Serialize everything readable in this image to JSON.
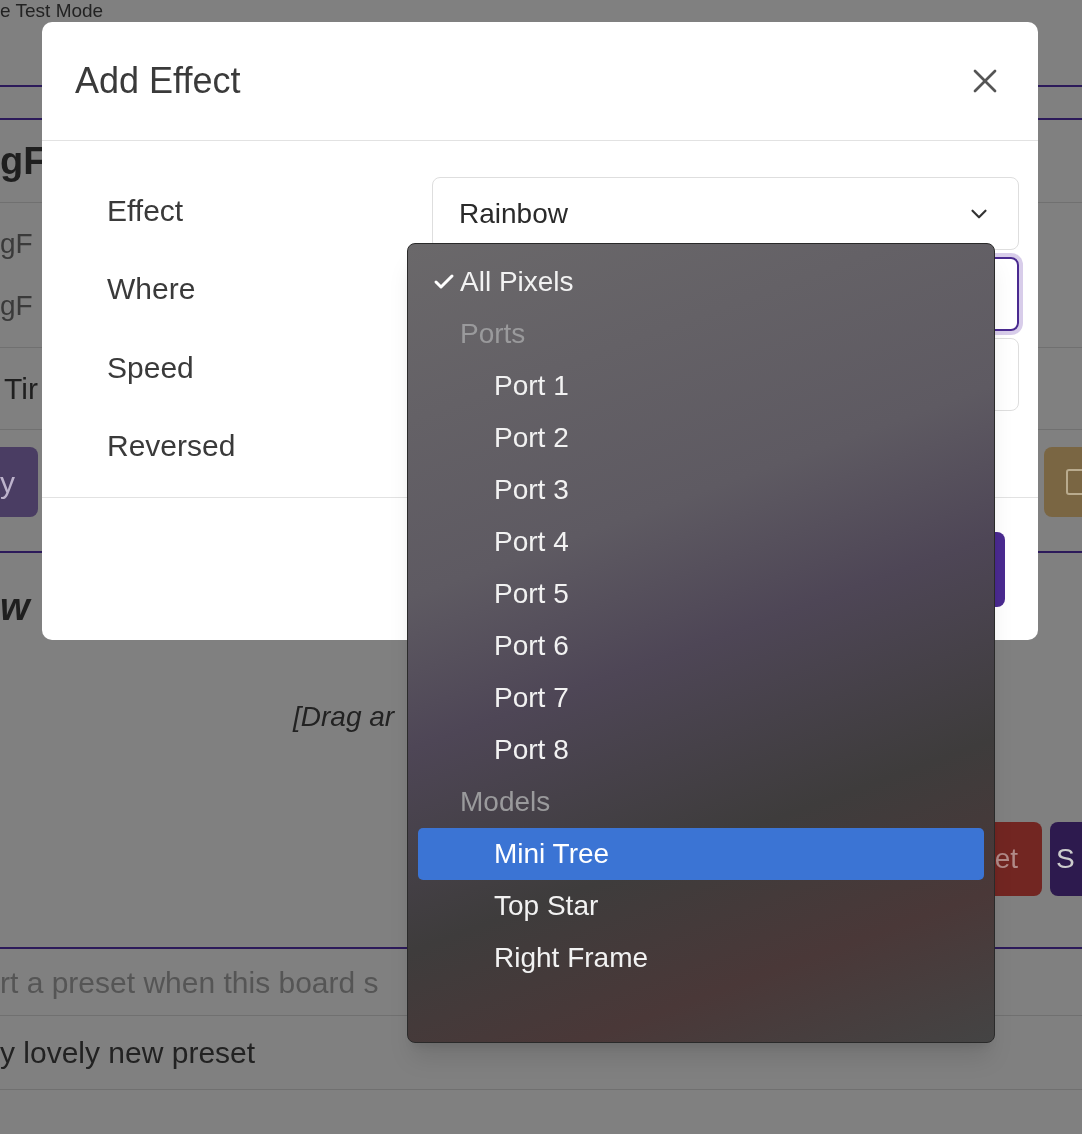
{
  "page": {
    "mode_title": "e Test Mode",
    "section_heading": "gF",
    "rows": [
      "gF",
      "gF"
    ],
    "field_label": "Tir",
    "left_button": "y",
    "second_heading": "w",
    "drop_hint": "[Drag ar",
    "reset_button": "et",
    "save_button": "S",
    "preset_placeholder": "rt a preset when this board s",
    "preset_name": "y lovely new preset"
  },
  "dialog": {
    "title": "Add Effect",
    "fields": [
      {
        "label": "Effect",
        "value": "Rainbow"
      },
      {
        "label": "Where"
      },
      {
        "label": "Speed"
      },
      {
        "label": "Reversed"
      }
    ]
  },
  "where_dropdown": {
    "options": [
      {
        "kind": "option",
        "label": "All Pixels",
        "checked": true,
        "selected": false
      },
      {
        "kind": "group",
        "label": "Ports"
      },
      {
        "kind": "option",
        "label": "Port 1",
        "checked": false,
        "selected": false
      },
      {
        "kind": "option",
        "label": "Port 2",
        "checked": false,
        "selected": false
      },
      {
        "kind": "option",
        "label": "Port 3",
        "checked": false,
        "selected": false
      },
      {
        "kind": "option",
        "label": "Port 4",
        "checked": false,
        "selected": false
      },
      {
        "kind": "option",
        "label": "Port 5",
        "checked": false,
        "selected": false
      },
      {
        "kind": "option",
        "label": "Port 6",
        "checked": false,
        "selected": false
      },
      {
        "kind": "option",
        "label": "Port 7",
        "checked": false,
        "selected": false
      },
      {
        "kind": "option",
        "label": "Port 8",
        "checked": false,
        "selected": false
      },
      {
        "kind": "group",
        "label": "Models"
      },
      {
        "kind": "option",
        "label": "Mini Tree",
        "checked": false,
        "selected": true
      },
      {
        "kind": "option",
        "label": "Top Star",
        "checked": false,
        "selected": false
      },
      {
        "kind": "option",
        "label": "Right Frame",
        "checked": false,
        "selected": false
      }
    ]
  }
}
